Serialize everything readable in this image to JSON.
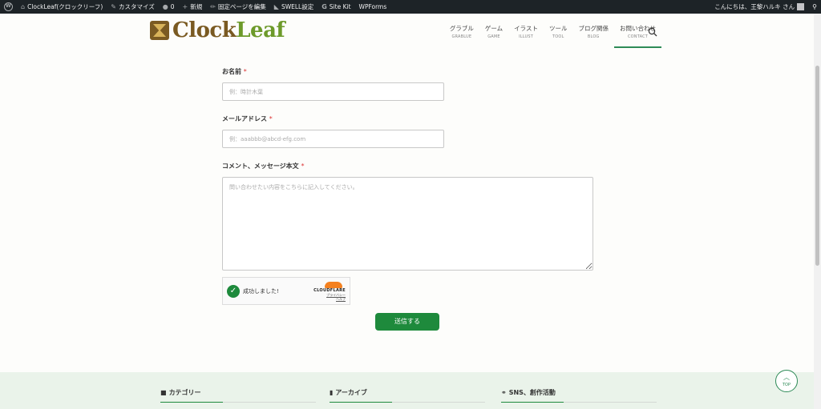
{
  "adminbar": {
    "site": "ClockLeaf(クロックリーフ)",
    "customize": "カスタマイズ",
    "comments_count": "0",
    "new": "新規",
    "edit_page": "固定ページを編集",
    "swell": "SWELL設定",
    "sitekit": "Site Kit",
    "wpforms": "WPForms",
    "greeting": "こんにちは、王黎ハルキ さん"
  },
  "header": {
    "logo_part1": "Clock",
    "logo_part2": "Leaf",
    "nav": [
      {
        "jp": "グラブル",
        "en": "GRABLUE"
      },
      {
        "jp": "ゲーム",
        "en": "GAME"
      },
      {
        "jp": "イラスト",
        "en": "ILLUST"
      },
      {
        "jp": "ツール",
        "en": "TOOL"
      },
      {
        "jp": "ブログ関係",
        "en": "BLOG"
      },
      {
        "jp": "お問い合わせ",
        "en": "CONTACT"
      }
    ]
  },
  "form": {
    "name_label": "お名前",
    "name_placeholder": "例：時計木葉",
    "email_label": "メールアドレス",
    "email_placeholder": "例：aaabbb@abcd-efg.com",
    "comment_label": "コメント、メッセージ本文",
    "comment_placeholder": "問い合わせたい内容をこちらに記入してください。",
    "required_mark": "*",
    "turnstile_success": "成功しました!",
    "turnstile_brand": "CLOUDFLARE",
    "turnstile_privacy": "プライバシー",
    "turnstile_help": "ヘルプ",
    "submit": "送信する"
  },
  "footer": {
    "categories": "カテゴリー",
    "archives": "アーカイブ",
    "sns": "SNS、創作活動"
  },
  "totop": {
    "label": "TOP"
  },
  "colors": {
    "accent": "#1e8a3c",
    "adminbar": "#1d2327",
    "footer_bg": "#eaf3ea"
  }
}
